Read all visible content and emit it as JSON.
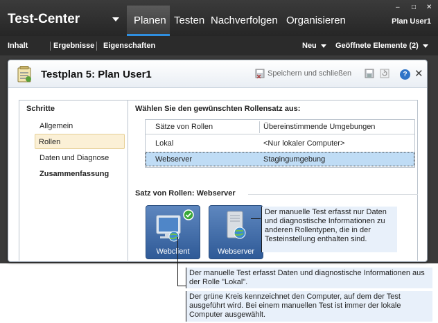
{
  "topbar": {
    "app_title": "Test-Center",
    "tabs": [
      "Planen",
      "Testen",
      "Nachverfolgen",
      "Organisieren"
    ],
    "active_tab": "Planen",
    "user": "Plan User1",
    "window_buttons": [
      "–",
      "□",
      "✕"
    ]
  },
  "subbar": {
    "items": [
      "Inhalt",
      "Ergebnisse",
      "Eigenschaften"
    ],
    "new_label": "Neu",
    "open_items_label": "Geöffnete Elemente (2)"
  },
  "window": {
    "title": "Testplan 5: Plan User1",
    "save_close_label": "Speichern und schließen",
    "help_label": "?",
    "close_label": "✕"
  },
  "left_panel": {
    "heading": "Schritte",
    "items": [
      {
        "label": "Allgemein"
      },
      {
        "label": "Rollen"
      },
      {
        "label": "Daten und Diagnose"
      },
      {
        "label": "Zusammenfassung"
      }
    ],
    "selected": "Rollen"
  },
  "role_sets": {
    "heading": "Wählen Sie den gewünschten Rollensatz aus:",
    "columns": [
      "Sätze von Rollen",
      "Übereinstimmende Umgebungen"
    ],
    "rows": [
      {
        "set": "Lokal",
        "env": "<Nur lokaler Computer>"
      },
      {
        "set": "Webserver",
        "env": "Stagingumgebung"
      }
    ],
    "selected_row": "Webserver"
  },
  "set_detail": {
    "heading": "Satz von Rollen: Webserver",
    "roles": [
      {
        "label": "Webclient",
        "icon": "client-computer-icon"
      },
      {
        "label": "Webserver",
        "icon": "server-icon"
      }
    ]
  },
  "callouts": {
    "right": "Der manuelle Test erfasst nur Daten und diagnostische Informationen zu anderen Rollentypen, die in der Testeinstellung enthalten sind.",
    "bottom1": "Der manuelle Test erfasst Daten und diagnostische Informationen aus der Rolle \"Lokal\".",
    "bottom2": "Der grüne Kreis kennzeichnet den Computer, auf dem der Test ausgeführt wird. Bei einem manuellen Test ist immer der lokale Computer ausgewählt."
  },
  "colors": {
    "accent": "#2f8fe0",
    "selection": "#bfdcf5",
    "tile": "#3d69a8",
    "callout_bg": "#e8f0fa"
  }
}
